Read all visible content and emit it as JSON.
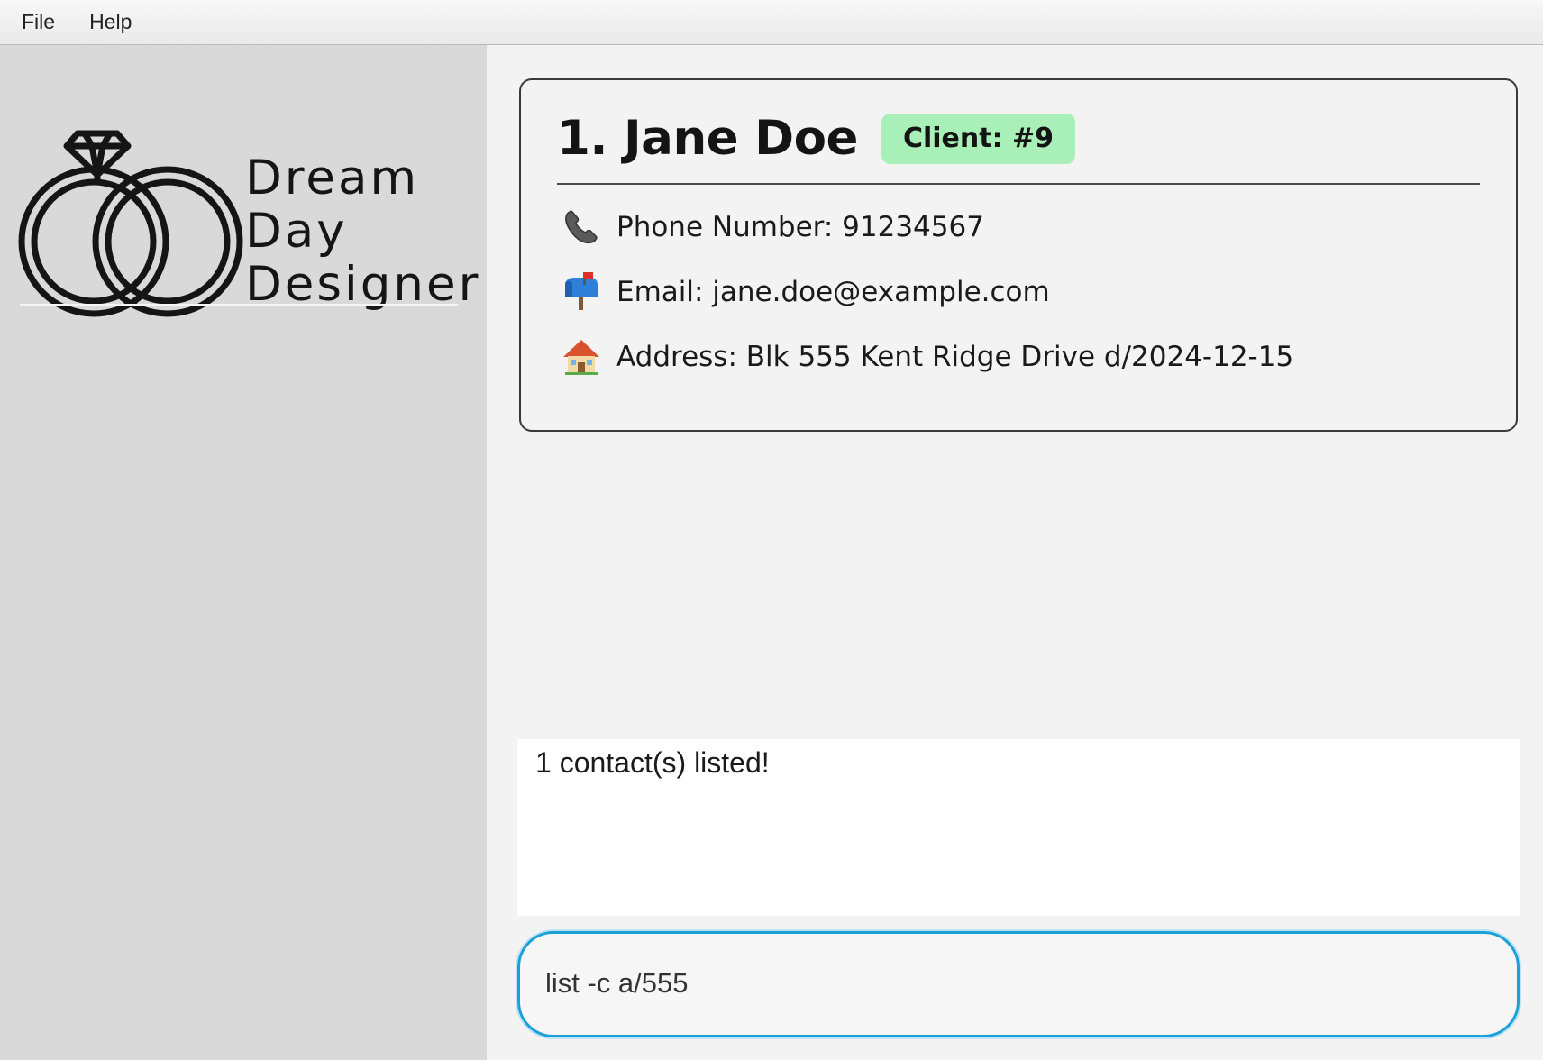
{
  "menu": {
    "file": "File",
    "help": "Help"
  },
  "logo": {
    "line1": "Dream",
    "line2": "Day",
    "line3": "Designer"
  },
  "card": {
    "name": "1. Jane Doe",
    "badge": "Client: #9",
    "phone": "Phone Number: 91234567",
    "email": "Email: jane.doe@example.com",
    "address": "Address: Blk 555 Kent Ridge Drive d/2024-12-15",
    "icons": {
      "phone": "phone-icon",
      "email": "mailbox-icon",
      "address": "house-icon"
    },
    "badge_color": "#a9f0b8"
  },
  "result": {
    "text": "1 contact(s) listed!"
  },
  "command": {
    "value": "list -c a/555"
  },
  "colors": {
    "accent": "#1ba0d8",
    "sidebar": "#d9d9d9"
  }
}
